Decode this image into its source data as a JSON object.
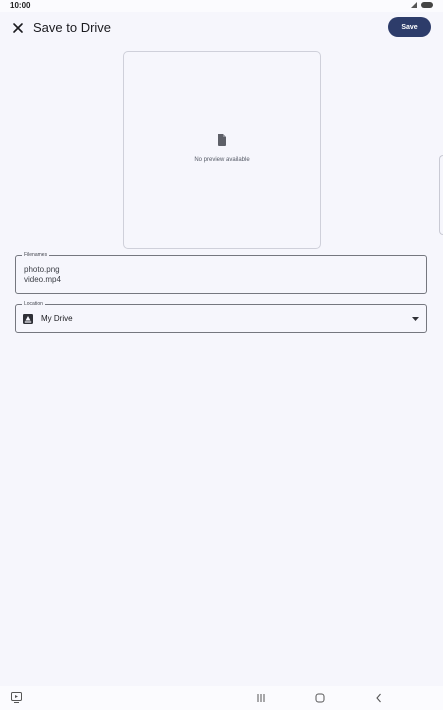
{
  "status_bar": {
    "time": "10:00"
  },
  "app_bar": {
    "title": "Save to Drive",
    "close_icon": "close-icon",
    "save_label": "Save"
  },
  "preview": {
    "icon": "file-icon",
    "message": "No preview available"
  },
  "filenames": {
    "label": "Filenames",
    "values": [
      "photo.png",
      "video.mp4"
    ]
  },
  "location": {
    "label": "Location",
    "value": "My Drive",
    "icon": "drive-icon",
    "dropdown_icon": "dropdown-arrow-icon"
  },
  "navigation": {
    "icons": [
      "keyboard-icon",
      "recents-icon",
      "home-icon",
      "back-icon"
    ]
  },
  "colors": {
    "background": "#f6f6fc",
    "save_button": "#2d3c6a",
    "outline": "#75777f"
  }
}
